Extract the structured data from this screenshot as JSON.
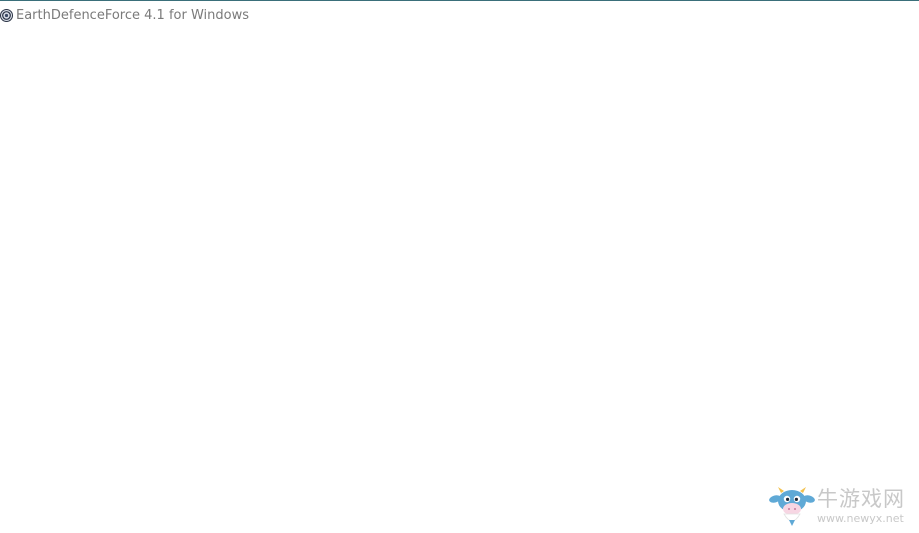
{
  "window": {
    "title": "EarthDefenceForce 4.1 for Windows",
    "icon": "app-icon"
  },
  "watermark": {
    "brand": "牛游戏网",
    "url": "www.newyx.net",
    "mascot_icon": "cow-mascot-icon"
  },
  "colors": {
    "title_text": "#7a7a7a",
    "top_border": "#3a6f7a",
    "background": "#ffffff",
    "watermark_text": "#c8c8c8",
    "mascot_blue": "#5fa9d6"
  }
}
